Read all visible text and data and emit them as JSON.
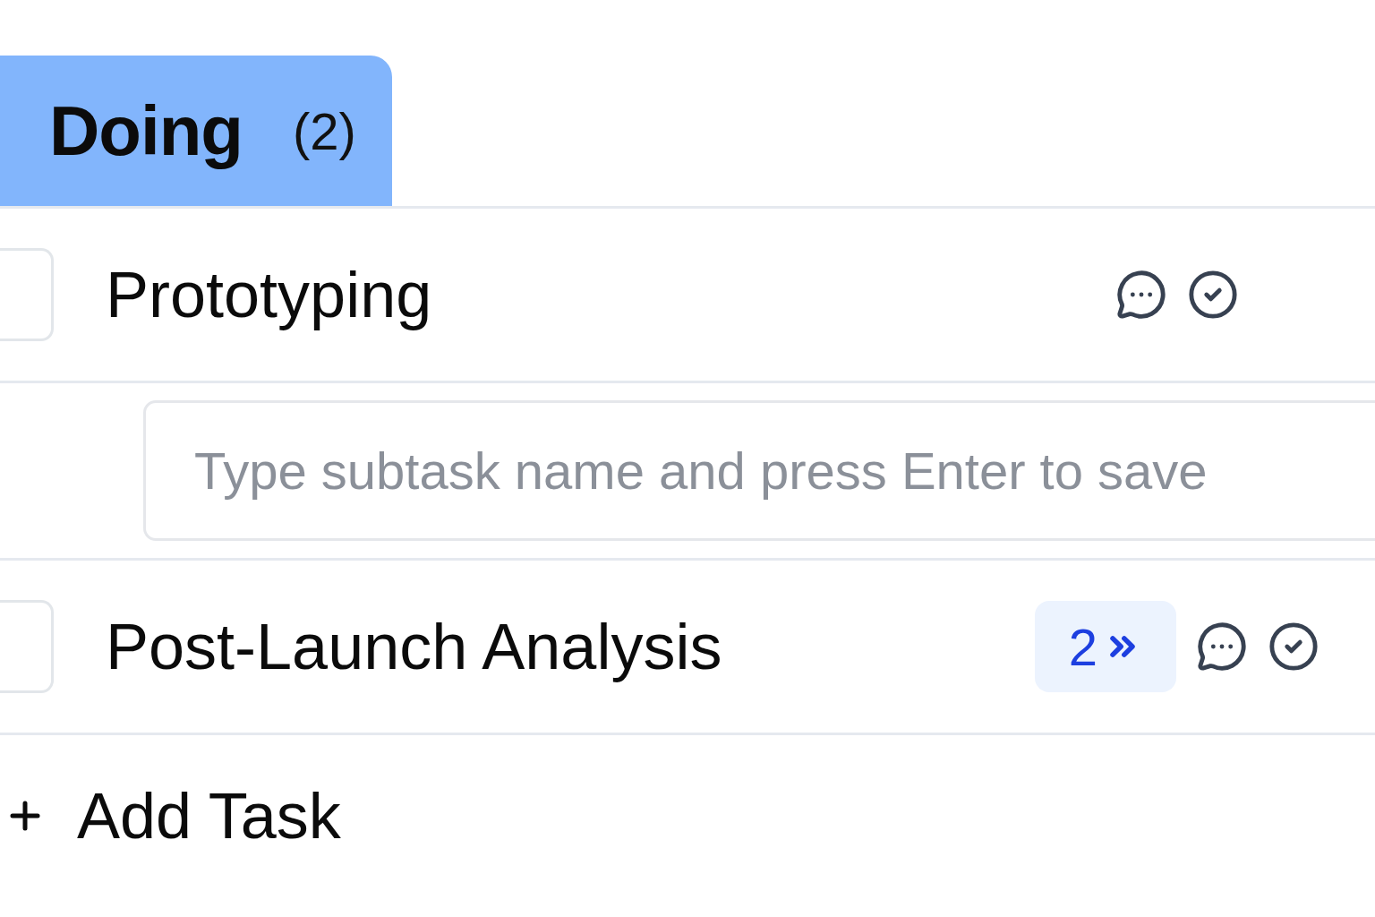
{
  "column": {
    "title": "Doing",
    "count": "(2)",
    "selected": true
  },
  "tasks": [
    {
      "title": "Prototyping",
      "checked": false,
      "subtask_input": {
        "placeholder": "Type subtask name and press Enter to save"
      }
    },
    {
      "title": "Post-Launch Analysis",
      "checked": false,
      "subtask_badge": "2"
    }
  ],
  "add_task": {
    "label": "Add Task"
  }
}
